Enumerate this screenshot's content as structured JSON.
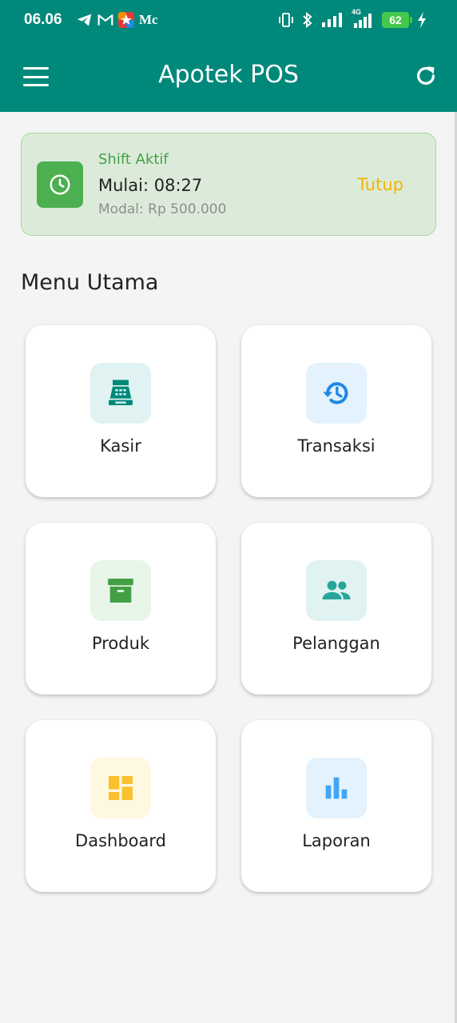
{
  "status_bar": {
    "time": "06.06",
    "left_icons": [
      "telegram-icon",
      "gmail-icon",
      "app-icon"
    ],
    "left_text": "Mc",
    "right_icons": [
      "vibrate-icon",
      "bluetooth-icon",
      "signal-icon",
      "signal-4g-icon",
      "charging-icon"
    ],
    "network_label": "4G",
    "battery_level": "62"
  },
  "app_bar": {
    "title": "Apotek POS",
    "left_icon": "menu-icon",
    "right_icon": "refresh-icon",
    "color": "#00897b"
  },
  "shift": {
    "status": "Shift Aktif",
    "start": "Mulai: 08:27",
    "capital": "Modal: Rp 500.000",
    "close_label": "Tutup",
    "icon": "clock-icon",
    "accent": "#4caf50",
    "close_color": "#f4b400"
  },
  "menu": {
    "title": "Menu Utama",
    "items": [
      {
        "label": "Kasir",
        "icon": "cash-register-icon",
        "color": "#00897b",
        "bg": "#e0f2f1"
      },
      {
        "label": "Transaksi",
        "icon": "history-icon",
        "color": "#1e88e5",
        "bg": "#e3f2fd"
      },
      {
        "label": "Produk",
        "icon": "archive-box-icon",
        "color": "#43a047",
        "bg": "#e8f5e9"
      },
      {
        "label": "Pelanggan",
        "icon": "people-icon",
        "color": "#26a69a",
        "bg": "#e0f2f1"
      },
      {
        "label": "Dashboard",
        "icon": "dashboard-icon",
        "color": "#fbc02d",
        "bg": "#fff8e1"
      },
      {
        "label": "Laporan",
        "icon": "bar-chart-icon",
        "color": "#42a5f5",
        "bg": "#e3f2fd"
      }
    ]
  }
}
